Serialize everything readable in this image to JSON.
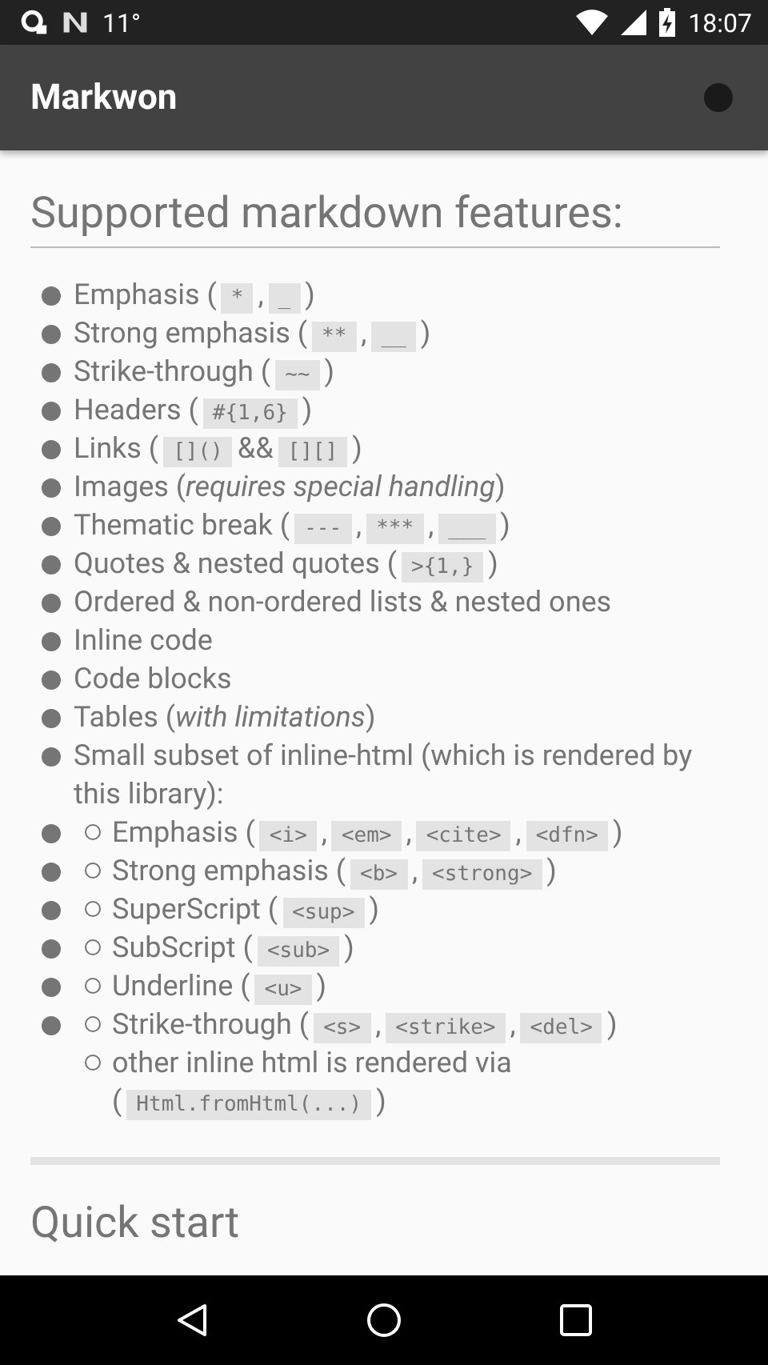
{
  "status_bar": {
    "temperature": "11°",
    "time": "18:07"
  },
  "app_bar": {
    "title": "Markwon"
  },
  "heading": "Supported markdown features:",
  "features": [
    {
      "segments": [
        {
          "kind": "text",
          "text": "Emphasis ("
        },
        {
          "kind": "code",
          "text": "*"
        },
        {
          "kind": "text",
          "text": ","
        },
        {
          "kind": "code",
          "text": "_"
        },
        {
          "kind": "text",
          "text": ")"
        }
      ]
    },
    {
      "segments": [
        {
          "kind": "text",
          "text": "Strong emphasis ("
        },
        {
          "kind": "code",
          "text": "**"
        },
        {
          "kind": "text",
          "text": ","
        },
        {
          "kind": "code",
          "text": "__"
        },
        {
          "kind": "text",
          "text": ")"
        }
      ]
    },
    {
      "segments": [
        {
          "kind": "text",
          "text": "Strike-through ("
        },
        {
          "kind": "code",
          "text": "~~"
        },
        {
          "kind": "text",
          "text": ")"
        }
      ]
    },
    {
      "segments": [
        {
          "kind": "text",
          "text": "Headers ("
        },
        {
          "kind": "code",
          "text": "#{1,6}"
        },
        {
          "kind": "text",
          "text": ")"
        }
      ]
    },
    {
      "segments": [
        {
          "kind": "text",
          "text": "Links ("
        },
        {
          "kind": "code",
          "text": "[]()"
        },
        {
          "kind": "text",
          "text": "&&"
        },
        {
          "kind": "code",
          "text": "[][]"
        },
        {
          "kind": "text",
          "text": ")"
        }
      ]
    },
    {
      "segments": [
        {
          "kind": "text",
          "text": "Images ("
        },
        {
          "kind": "italic",
          "text": "requires special handling"
        },
        {
          "kind": "text",
          "text": ")"
        }
      ]
    },
    {
      "segments": [
        {
          "kind": "text",
          "text": "Thematic break ("
        },
        {
          "kind": "code",
          "text": "---"
        },
        {
          "kind": "text",
          "text": ","
        },
        {
          "kind": "code",
          "text": "***"
        },
        {
          "kind": "text",
          "text": ","
        },
        {
          "kind": "code",
          "text": "___"
        },
        {
          "kind": "text",
          "text": ")"
        }
      ]
    },
    {
      "segments": [
        {
          "kind": "text",
          "text": "Quotes & nested quotes ("
        },
        {
          "kind": "code",
          "text": ">{1,}"
        },
        {
          "kind": "text",
          "text": ")"
        }
      ]
    },
    {
      "segments": [
        {
          "kind": "text",
          "text": "Ordered & non-ordered lists & nested ones"
        }
      ]
    },
    {
      "segments": [
        {
          "kind": "text",
          "text": "Inline code"
        }
      ]
    },
    {
      "segments": [
        {
          "kind": "text",
          "text": "Code blocks"
        }
      ]
    },
    {
      "segments": [
        {
          "kind": "text",
          "text": "Tables ("
        },
        {
          "kind": "italic",
          "text": "with limitations"
        },
        {
          "kind": "text",
          "text": ")"
        }
      ]
    },
    {
      "segments": [
        {
          "kind": "text",
          "text": "Small subset of inline-html (which is rendered by this library):"
        }
      ],
      "children": [
        {
          "outer_bullet": true,
          "segments": [
            {
              "kind": "text",
              "text": "Emphasis ("
            },
            {
              "kind": "code",
              "text": "<i>"
            },
            {
              "kind": "text",
              "text": ","
            },
            {
              "kind": "code",
              "text": "<em>"
            },
            {
              "kind": "text",
              "text": ","
            },
            {
              "kind": "code",
              "text": "<cite>"
            },
            {
              "kind": "text",
              "text": ","
            },
            {
              "kind": "code",
              "text": "<dfn>"
            },
            {
              "kind": "text",
              "text": ")"
            }
          ]
        },
        {
          "outer_bullet": true,
          "segments": [
            {
              "kind": "text",
              "text": "Strong emphasis ("
            },
            {
              "kind": "code",
              "text": "<b>"
            },
            {
              "kind": "text",
              "text": ","
            },
            {
              "kind": "code",
              "text": "<strong>"
            },
            {
              "kind": "text",
              "text": ")"
            }
          ]
        },
        {
          "outer_bullet": true,
          "segments": [
            {
              "kind": "text",
              "text": "SuperScript ("
            },
            {
              "kind": "code",
              "text": "<sup>"
            },
            {
              "kind": "text",
              "text": ")"
            }
          ]
        },
        {
          "outer_bullet": true,
          "segments": [
            {
              "kind": "text",
              "text": "SubScript ("
            },
            {
              "kind": "code",
              "text": "<sub>"
            },
            {
              "kind": "text",
              "text": ")"
            }
          ]
        },
        {
          "outer_bullet": true,
          "segments": [
            {
              "kind": "text",
              "text": "Underline ("
            },
            {
              "kind": "code",
              "text": "<u>"
            },
            {
              "kind": "text",
              "text": ")"
            }
          ]
        },
        {
          "outer_bullet": true,
          "segments": [
            {
              "kind": "text",
              "text": "Strike-through ("
            },
            {
              "kind": "code",
              "text": "<s>"
            },
            {
              "kind": "text",
              "text": ","
            },
            {
              "kind": "code",
              "text": "<strike>"
            },
            {
              "kind": "text",
              "text": ","
            },
            {
              "kind": "code",
              "text": "<del>"
            },
            {
              "kind": "text",
              "text": ")"
            }
          ]
        },
        {
          "outer_bullet": false,
          "segments": [
            {
              "kind": "text",
              "text": "other inline html is rendered via ("
            },
            {
              "kind": "code",
              "text": "Html.fromHtml(...)"
            },
            {
              "kind": "text",
              "text": ")"
            }
          ]
        }
      ]
    }
  ],
  "next_heading": "Quick start"
}
